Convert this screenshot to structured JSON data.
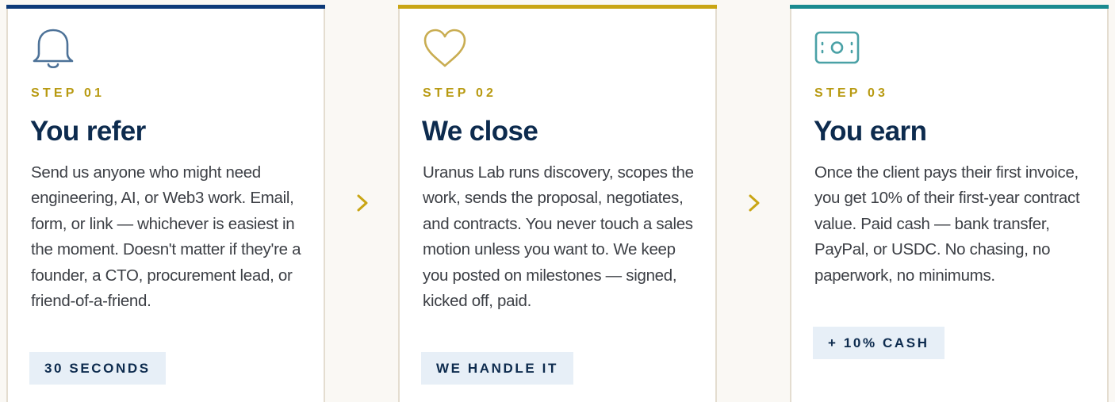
{
  "colors": {
    "step1_accent": "#0d3a78",
    "step2_accent": "#c9a514",
    "step3_accent": "#1a8a8f",
    "label_gold": "#b89a12",
    "title_navy": "#0d2b4e",
    "badge_bg": "#e7eff7"
  },
  "steps": [
    {
      "icon": "bell-icon",
      "step_label": "STEP 01",
      "title": "You refer",
      "description": "Send us anyone who might need engineering, AI, or Web3 work. Email, form, or link — whichever is easiest in the moment. Doesn't matter if they're a founder, a CTO, procurement lead, or friend-of-a-friend.",
      "badge": "30 SECONDS"
    },
    {
      "icon": "heart-icon",
      "step_label": "STEP 02",
      "title": "We close",
      "description": "Uranus Lab runs discovery, scopes the work, sends the proposal, negotiates, and contracts. You never touch a sales motion unless you want to. We keep you posted on milestones — signed, kicked off, paid.",
      "badge": "WE HANDLE IT"
    },
    {
      "icon": "cash-icon",
      "step_label": "STEP 03",
      "title": "You earn",
      "description": "Once the client pays their first invoice, you get 10% of their first-year contract value. Paid cash — bank transfer, PayPal, or USDC. No chasing, no paperwork, no minimums.",
      "badge": "+ 10% CASH"
    }
  ],
  "connectors": [
    "chevron-right-icon",
    "chevron-right-icon"
  ]
}
